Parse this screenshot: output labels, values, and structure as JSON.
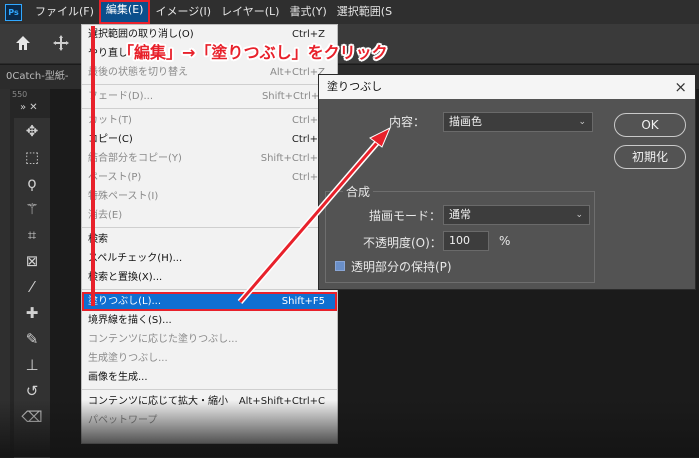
{
  "menubar": {
    "app_icon": "Ps",
    "items": [
      "ファイル(F)",
      "編集(E)",
      "イメージ(I)",
      "レイヤー(L)",
      "書式(Y)",
      "選択範囲(S"
    ]
  },
  "options_bar": {
    "icons": [
      "home-icon",
      "move-icon"
    ]
  },
  "doc_tab": {
    "label": "0Catch-型紙-"
  },
  "ruler_label": "550",
  "menu": {
    "items": [
      {
        "label": "選択範囲の取り消し(O)",
        "shortcut": "Ctrl+Z",
        "enabled": true
      },
      {
        "label": "やり直し",
        "shortcut": "",
        "enabled": true
      },
      {
        "label": "最後の状態を切り替え",
        "shortcut": "Alt+Ctrl+Z",
        "enabled": false
      },
      {
        "label": "フェード(D)...",
        "shortcut": "Shift+Ctrl+F",
        "enabled": false
      },
      {
        "label": "カット(T)",
        "shortcut": "Ctrl+X",
        "enabled": false
      },
      {
        "label": "コピー(C)",
        "shortcut": "Ctrl+C",
        "enabled": true
      },
      {
        "label": "結合部分をコピー(Y)",
        "shortcut": "Shift+Ctrl+C",
        "enabled": false
      },
      {
        "label": "ペースト(P)",
        "shortcut": "Ctrl+V",
        "enabled": false
      },
      {
        "label": "特殊ペースト(I)",
        "shortcut": "",
        "enabled": false
      },
      {
        "label": "消去(E)",
        "shortcut": "",
        "enabled": false
      },
      {
        "label": "検索",
        "shortcut": "",
        "enabled": true
      },
      {
        "label": "スペルチェック(H)...",
        "shortcut": "",
        "enabled": true
      },
      {
        "label": "検索と置換(X)...",
        "shortcut": "",
        "enabled": true
      },
      {
        "label": "塗りつぶし(L)...",
        "shortcut": "Shift+F5",
        "enabled": true
      },
      {
        "label": "境界線を描く(S)...",
        "shortcut": "",
        "enabled": true
      },
      {
        "label": "コンテンツに応じた塗りつぶし...",
        "shortcut": "",
        "enabled": false
      },
      {
        "label": "生成塗りつぶし...",
        "shortcut": "",
        "enabled": false
      },
      {
        "label": "画像を生成...",
        "shortcut": "",
        "enabled": true
      },
      {
        "label": "コンテンツに応じて拡大・縮小",
        "shortcut": "Alt+Shift+Ctrl+C",
        "enabled": true
      },
      {
        "label": "パペットワープ",
        "shortcut": "",
        "enabled": false
      }
    ]
  },
  "annotation": "「編集」→「塗りつぶし」をクリック",
  "dialog": {
    "title": "塗りつぶし",
    "close": "×",
    "contents_label": "内容：",
    "contents_value": "描画色",
    "ok": "OK",
    "reset": "初期化",
    "blend_group": "合成",
    "mode_label": "描画モード：",
    "mode_value": "通常",
    "opacity_label": "不透明度(O)：",
    "opacity_value": "100",
    "opacity_unit": "%",
    "preserve_label": "透明部分の保持(P)"
  },
  "colors": {
    "highlight": "#e8212b",
    "menu_selection": "#0f6fd1"
  }
}
